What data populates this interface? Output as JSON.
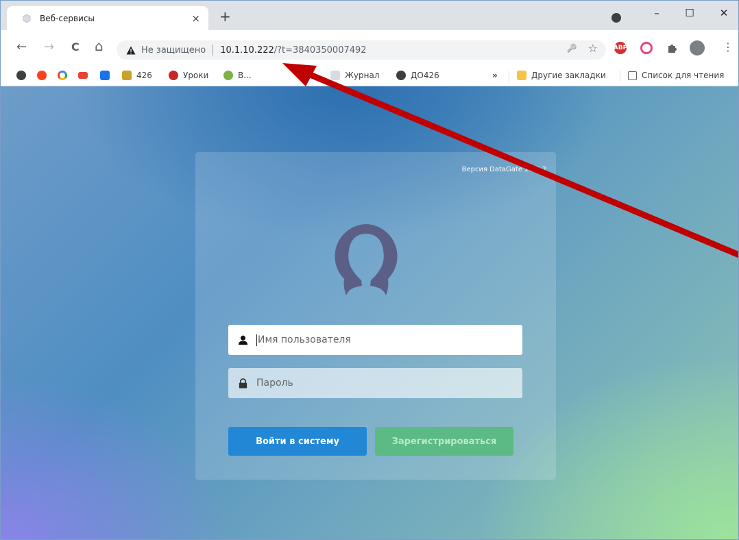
{
  "browser": {
    "tab_title": "Веб-сервисы",
    "tab_close": "×",
    "new_tab": "+",
    "window_controls": {
      "minimize": "–",
      "maximize": "☐",
      "close": "✕"
    }
  },
  "toolbar": {
    "back": "←",
    "forward": "→",
    "reload": "C",
    "home": "⌂",
    "security_icon": "warning-triangle-icon",
    "insecure_label": "Не защищено",
    "url_host": "10.1.10.222",
    "url_rest": "/?t=3840350007492",
    "key_icon": "🔑",
    "star_icon": "☆",
    "menu_icon": "⋮",
    "abp_label": "ABP"
  },
  "bookmarks": {
    "items": [
      {
        "label": "",
        "icon": "globe-icon"
      },
      {
        "label": "",
        "icon": "yandex-icon"
      },
      {
        "label": "",
        "icon": "google-icon"
      },
      {
        "label": "",
        "icon": "gmail-icon"
      },
      {
        "label": "",
        "icon": "mail-icon"
      },
      {
        "label": "426",
        "icon": "portal-icon"
      },
      {
        "label": "Уроки",
        "icon": "apple-icon"
      },
      {
        "label": "В...",
        "icon": "ball-icon"
      },
      {
        "label": "Журнал",
        "icon": "journal-icon"
      },
      {
        "label": "ДО426",
        "icon": "globe-icon"
      }
    ],
    "overflow": "»",
    "other_bookmarks": "Другие закладки",
    "reading_list": "Список для чтения"
  },
  "login": {
    "version": "Версия DataGate 21.9.2",
    "username_placeholder": "Имя пользователя",
    "password_placeholder": "Пароль",
    "login_button": "Войти в систему",
    "register_button": "Зарегистрироваться"
  },
  "colors": {
    "login_button": "#2288d6",
    "register_button": "#5cba84",
    "avatar": "#5b5f85",
    "annotation_arrow": "#c00000"
  }
}
